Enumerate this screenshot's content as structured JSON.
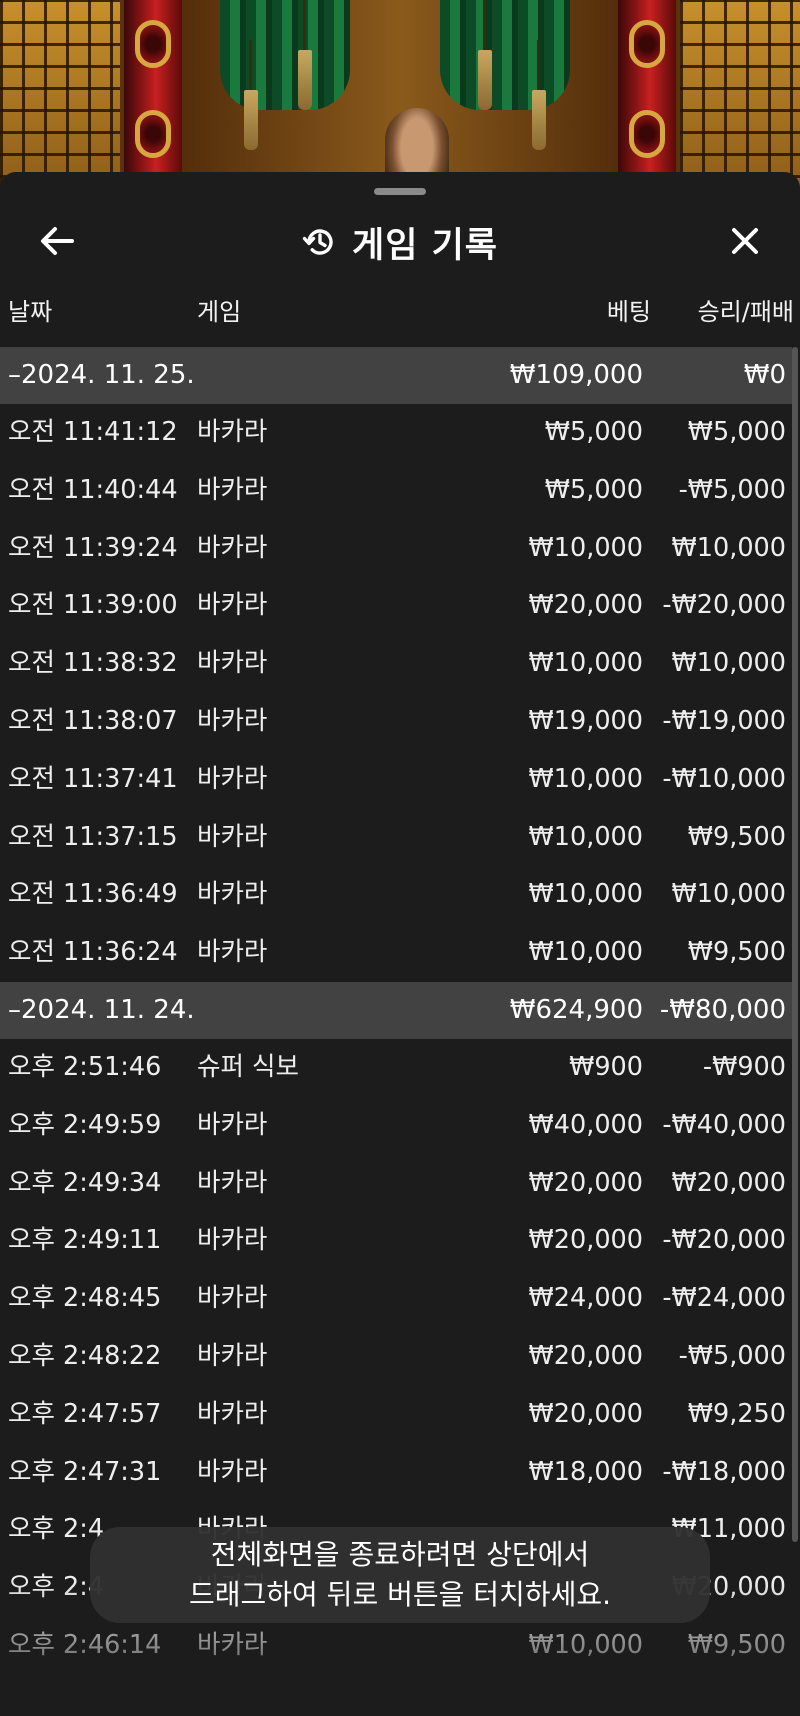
{
  "header": {
    "title": "게임 기록",
    "back_icon": "arrow-left-icon",
    "history_icon": "history-clock-icon",
    "close_icon": "close-icon"
  },
  "columns": {
    "date": "날짜",
    "game": "게임",
    "bet": "베팅",
    "pnl": "승리/패배"
  },
  "groups": [
    {
      "date": "–2024. 11. 25.",
      "bet_total": "₩109,000",
      "pnl_total": "₩0",
      "rows": [
        {
          "time": "오전 11:41:12",
          "game": "바카라",
          "bet": "₩5,000",
          "pnl": "₩5,000"
        },
        {
          "time": "오전 11:40:44",
          "game": "바카라",
          "bet": "₩5,000",
          "pnl": "-₩5,000"
        },
        {
          "time": "오전 11:39:24",
          "game": "바카라",
          "bet": "₩10,000",
          "pnl": "₩10,000"
        },
        {
          "time": "오전 11:39:00",
          "game": "바카라",
          "bet": "₩20,000",
          "pnl": "-₩20,000"
        },
        {
          "time": "오전 11:38:32",
          "game": "바카라",
          "bet": "₩10,000",
          "pnl": "₩10,000"
        },
        {
          "time": "오전 11:38:07",
          "game": "바카라",
          "bet": "₩19,000",
          "pnl": "-₩19,000"
        },
        {
          "time": "오전 11:37:41",
          "game": "바카라",
          "bet": "₩10,000",
          "pnl": "-₩10,000"
        },
        {
          "time": "오전 11:37:15",
          "game": "바카라",
          "bet": "₩10,000",
          "pnl": "₩9,500"
        },
        {
          "time": "오전 11:36:49",
          "game": "바카라",
          "bet": "₩10,000",
          "pnl": "₩10,000"
        },
        {
          "time": "오전 11:36:24",
          "game": "바카라",
          "bet": "₩10,000",
          "pnl": "₩9,500"
        }
      ]
    },
    {
      "date": "–2024. 11. 24.",
      "bet_total": "₩624,900",
      "pnl_total": "-₩80,000",
      "rows": [
        {
          "time": "오후 2:51:46",
          "game": "슈퍼 식보",
          "bet": "₩900",
          "pnl": "-₩900"
        },
        {
          "time": "오후 2:49:59",
          "game": "바카라",
          "bet": "₩40,000",
          "pnl": "-₩40,000"
        },
        {
          "time": "오후 2:49:34",
          "game": "바카라",
          "bet": "₩20,000",
          "pnl": "₩20,000"
        },
        {
          "time": "오후 2:49:11",
          "game": "바카라",
          "bet": "₩20,000",
          "pnl": "-₩20,000"
        },
        {
          "time": "오후 2:48:45",
          "game": "바카라",
          "bet": "₩24,000",
          "pnl": "-₩24,000"
        },
        {
          "time": "오후 2:48:22",
          "game": "바카라",
          "bet": "₩20,000",
          "pnl": "-₩5,000"
        },
        {
          "time": "오후 2:47:57",
          "game": "바카라",
          "bet": "₩20,000",
          "pnl": "₩9,250"
        },
        {
          "time": "오후 2:47:31",
          "game": "바카라",
          "bet": "₩18,000",
          "pnl": "-₩18,000"
        },
        {
          "time": "오후 2:4",
          "game": "바카라",
          "bet": "",
          "pnl": "₩11,000"
        },
        {
          "time": "오후 2:4",
          "game": "바카라",
          "bet": "",
          "pnl": "₩20,000"
        },
        {
          "time": "오후 2:46:14",
          "game": "바카라",
          "bet": "₩10,000",
          "pnl": "₩9,500"
        }
      ]
    }
  ],
  "toast": {
    "line1": "전체화면을 종료하려면 상단에서",
    "line2": "드래그하여 뒤로 버튼을 터치하세요."
  },
  "colors": {
    "sheet_bg": "#1c1c1c",
    "group_header_bg": "#424242",
    "text": "#ffffff",
    "toast_bg": "#303030"
  }
}
